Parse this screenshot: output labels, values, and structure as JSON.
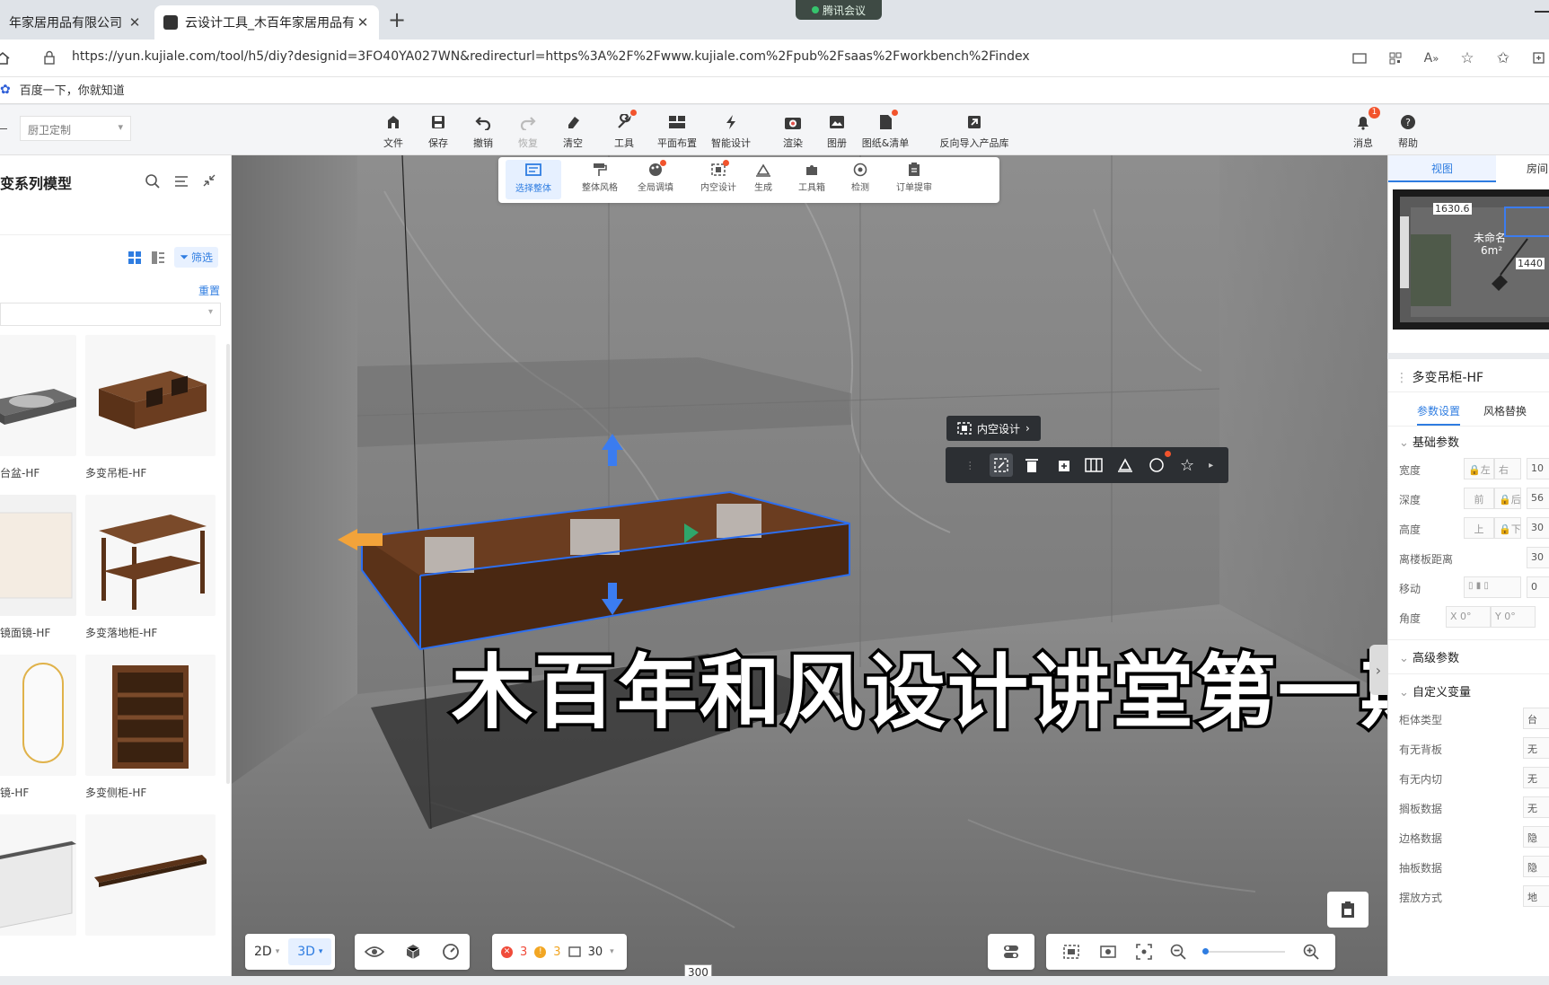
{
  "browser": {
    "tabs": [
      {
        "title": "年家居用品有限公司"
      },
      {
        "title": "云设计工具_木百年家居用品有限"
      }
    ],
    "meeting_label": "腾讯会议",
    "url": "https://yun.kujiale.com/tool/h5/diy?designid=3FO40YA027WN&redirecturl=https%3A%2F%2Fwww.kujiale.com%2Fpub%2Fsaas%2Fworkbench%2Findex",
    "bookmark": "百度一下，你就知道"
  },
  "toolbar": {
    "room_select": "厨卫定制",
    "tools": [
      {
        "label": "文件",
        "icon": "file-icon"
      },
      {
        "label": "保存",
        "icon": "save-icon"
      },
      {
        "label": "撤销",
        "icon": "undo-icon"
      },
      {
        "label": "恢复",
        "icon": "redo-icon"
      },
      {
        "label": "清空",
        "icon": "eraser-icon"
      },
      {
        "label": "工具",
        "icon": "wrench-icon"
      },
      {
        "label": "平面布置",
        "icon": "floorplan-icon"
      },
      {
        "label": "智能设计",
        "icon": "lightning-icon"
      },
      {
        "label": "渲染",
        "icon": "camera-icon"
      },
      {
        "label": "图册",
        "icon": "album-icon"
      },
      {
        "label": "图纸&清单",
        "icon": "drawing-list-icon"
      },
      {
        "label": "反向导入产品库",
        "icon": "import-icon"
      }
    ],
    "right_tools": [
      {
        "label": "消息",
        "badge": "1"
      },
      {
        "label": "帮助"
      }
    ]
  },
  "left_panel": {
    "title": "变系列模型",
    "filter_label": "筛选",
    "reset_label": "重置",
    "products": [
      {
        "name": "台盆-HF"
      },
      {
        "name": "多变吊柜-HF"
      },
      {
        "name": "镜面镜-HF"
      },
      {
        "name": "多变落地柜-HF"
      },
      {
        "name": "镜-HF"
      },
      {
        "name": "多变侧柜-HF"
      },
      {
        "name": ""
      },
      {
        "name": ""
      }
    ]
  },
  "sub_toolbar": {
    "tools": [
      {
        "label": "选择整体"
      },
      {
        "label": "整体风格"
      },
      {
        "label": "全局调填"
      },
      {
        "label": "内空设计"
      },
      {
        "label": "生成"
      },
      {
        "label": "工具箱"
      },
      {
        "label": "检测"
      },
      {
        "label": "订单提审"
      }
    ]
  },
  "viewport": {
    "inner_design_tip": "内空设计",
    "overlay_title": "木百年和风设计讲堂第一期",
    "dimension_label": "300",
    "bottom": {
      "view_2d": "2D",
      "view_3d": "3D",
      "errors": "3",
      "warnings": "3",
      "count": "30"
    }
  },
  "minimap": {
    "tab_view": "视图",
    "tab_room": "房间",
    "dim_top": "1630.6",
    "dim_right": "1440",
    "room_name": "未命名",
    "room_area": "6m²"
  },
  "properties": {
    "title": "多变吊柜-HF",
    "tab_params": "参数设置",
    "tab_style": "风格替换",
    "section_basic": "基础参数",
    "basic_rows": [
      {
        "label": "宽度",
        "a": "左",
        "b": "右",
        "v": "10"
      },
      {
        "label": "深度",
        "a": "前",
        "b": "后",
        "v": "56"
      },
      {
        "label": "高度",
        "a": "上",
        "b": "下",
        "v": "30"
      },
      {
        "label": "离楼板距离",
        "a": "",
        "b": "",
        "v": "30"
      },
      {
        "label": "移动",
        "a": "",
        "b": "",
        "v": "0"
      },
      {
        "label": "角度",
        "a": "X 0°",
        "b": "Y 0°",
        "v": ""
      }
    ],
    "section_advanced": "高级参数",
    "section_custom": "自定义变量",
    "custom_rows": [
      {
        "label": "柜体类型",
        "v": "台"
      },
      {
        "label": "有无背板",
        "v": "无"
      },
      {
        "label": "有无内切",
        "v": "无"
      },
      {
        "label": "搁板数据",
        "v": "无"
      },
      {
        "label": "边格数据",
        "v": "隐"
      },
      {
        "label": "抽板数据",
        "v": "隐"
      },
      {
        "label": "摆放方式",
        "v": "地"
      }
    ]
  }
}
